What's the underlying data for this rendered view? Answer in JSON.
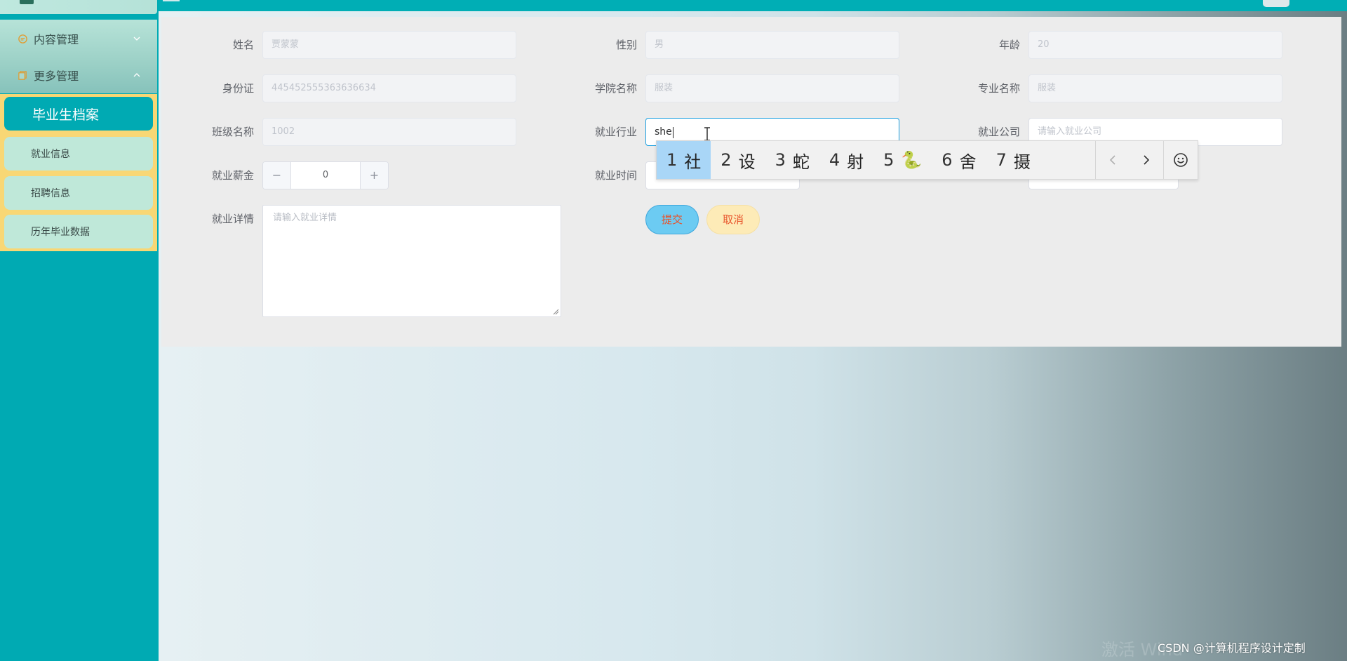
{
  "sidebar": {
    "menu": [
      {
        "label": "内容管理"
      },
      {
        "label": "更多管理"
      }
    ],
    "submenu": [
      {
        "label": "毕业生档案"
      },
      {
        "label": "就业信息"
      },
      {
        "label": "招聘信息"
      },
      {
        "label": "历年毕业数据"
      }
    ]
  },
  "form": {
    "fields": {
      "name": {
        "label": "姓名",
        "value": "贾蒙蒙"
      },
      "gender": {
        "label": "性别",
        "value": "男"
      },
      "age": {
        "label": "年龄",
        "value": "20"
      },
      "id_card": {
        "label": "身份证",
        "value": "445452555363636634"
      },
      "college": {
        "label": "学院名称",
        "value": "服装"
      },
      "major": {
        "label": "专业名称",
        "value": "服装"
      },
      "class": {
        "label": "班级名称",
        "value": "1002"
      },
      "industry": {
        "label": "就业行业",
        "value": "she"
      },
      "company": {
        "label": "就业公司",
        "placeholder": "请输入就业公司"
      },
      "salary": {
        "label": "就业薪金",
        "value": "0",
        "minus": "−",
        "plus": "+"
      },
      "time": {
        "label": "就业时间"
      },
      "details": {
        "label": "就业详情",
        "placeholder": "请输入就业详情"
      }
    },
    "buttons": {
      "submit": "提交",
      "cancel": "取消"
    }
  },
  "ime": {
    "candidates": [
      {
        "num": "1",
        "text": "社"
      },
      {
        "num": "2",
        "text": "设"
      },
      {
        "num": "3",
        "text": "蛇"
      },
      {
        "num": "4",
        "text": "射"
      },
      {
        "num": "5",
        "text": "🐍"
      },
      {
        "num": "6",
        "text": "舍"
      },
      {
        "num": "7",
        "text": "摄"
      }
    ],
    "selected_index": 0,
    "prev_icon": "chevron-left-icon",
    "next_icon": "chevron-right-icon",
    "emoji_icon": "smiley-icon"
  },
  "watermark": "激活 Wind",
  "credit": "CSDN @计算机程序设计定制",
  "colors": {
    "sidebar": "#00aab3",
    "submenu_bg": "#f8d775",
    "active_item": "#00aab3",
    "submit_bg": "#6ccbf2",
    "cancel_bg": "#fdebb7",
    "focus_border": "#1ea0e0",
    "button_text": "#e8532a"
  }
}
